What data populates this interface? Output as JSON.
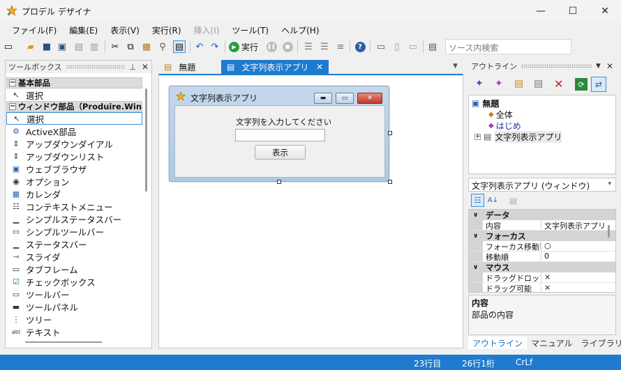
{
  "window": {
    "title": "プロデル デザイナ",
    "minimize": "—",
    "maximize": "☐",
    "close": "✕"
  },
  "menu": [
    {
      "label": "ファイル(F)",
      "enabled": true
    },
    {
      "label": "編集(E)",
      "enabled": true
    },
    {
      "label": "表示(V)",
      "enabled": true
    },
    {
      "label": "実行(R)",
      "enabled": true
    },
    {
      "label": "挿入(I)",
      "enabled": false
    },
    {
      "label": "ツール(T)",
      "enabled": true
    },
    {
      "label": "ヘルプ(H)",
      "enabled": true
    }
  ],
  "toolbar": {
    "run_label": "実行",
    "search_placeholder": "ソース内検索"
  },
  "toolbox": {
    "title": "ツールボックス",
    "groups": [
      {
        "label": "基本部品",
        "items": [
          {
            "label": "選択",
            "icon": "cursor-icon"
          }
        ]
      },
      {
        "label": "ウィンドウ部品（Produire.WinContr",
        "items": [
          {
            "label": "選択",
            "icon": "cursor-icon",
            "selected": true
          },
          {
            "label": "ActiveX部品",
            "icon": "gear-icon"
          },
          {
            "label": "アップダウンダイアル",
            "icon": "updown-icon"
          },
          {
            "label": "アップダウンリスト",
            "icon": "updown-list-icon"
          },
          {
            "label": "ウェブブラウザ",
            "icon": "browser-icon"
          },
          {
            "label": "オプション",
            "icon": "radio-icon"
          },
          {
            "label": "カレンダ",
            "icon": "calendar-icon"
          },
          {
            "label": "コンテキストメニュー",
            "icon": "context-menu-icon"
          },
          {
            "label": "シンプルステータスバー",
            "icon": "statusbar-icon"
          },
          {
            "label": "シンプルツールバー",
            "icon": "toolbar-icon"
          },
          {
            "label": "ステータスバー",
            "icon": "statusbar-icon"
          },
          {
            "label": "スライダ",
            "icon": "slider-icon"
          },
          {
            "label": "タブフレーム",
            "icon": "folder-icon"
          },
          {
            "label": "チェックボックス",
            "icon": "checkbox-icon"
          },
          {
            "label": "ツールバー",
            "icon": "toolbar-icon"
          },
          {
            "label": "ツールパネル",
            "icon": "panel-icon"
          },
          {
            "label": "ツリー",
            "icon": "tree-icon"
          },
          {
            "label": "テキスト",
            "icon": "textbox-icon"
          }
        ]
      }
    ]
  },
  "editor": {
    "tabs": [
      {
        "label": "無題",
        "active": false
      },
      {
        "label": "文字列表示アプリ",
        "active": true
      }
    ],
    "tab_close": "✕",
    "form": {
      "title": "文字列表示アプリ",
      "label": "文字列を入力してください",
      "textbox_value": "",
      "button_label": "表示"
    }
  },
  "outline": {
    "title": "アウトライン",
    "tree": {
      "root": "無題",
      "children": [
        "全体",
        "はじめ"
      ],
      "node": "文字列表示アプリ"
    }
  },
  "properties": {
    "selected_object": "文字列表示アプリ (ウィンドウ)",
    "categories": [
      {
        "label": "データ",
        "rows": [
          {
            "key": "内容",
            "value": "文字列表示アプリ"
          }
        ]
      },
      {
        "label": "フォーカス",
        "rows": [
          {
            "key": "フォーカス移動可",
            "value": "○"
          },
          {
            "key": "移動順",
            "value": "0"
          }
        ]
      },
      {
        "label": "マウス",
        "rows": [
          {
            "key": "ドラッグドロップ",
            "value": "×"
          },
          {
            "key": "ドラッグ可能",
            "value": "×"
          }
        ]
      }
    ],
    "description_title": "内容",
    "description_text": "部品の内容"
  },
  "right_tabs": [
    "アウトライン",
    "マニュアル",
    "ライブラリ"
  ],
  "status": {
    "line": "23行目",
    "column": "26行1桁",
    "eol": "CrLf"
  },
  "colors": {
    "accent": "#1e7bd0",
    "statusbar": "#1e7bd0"
  }
}
